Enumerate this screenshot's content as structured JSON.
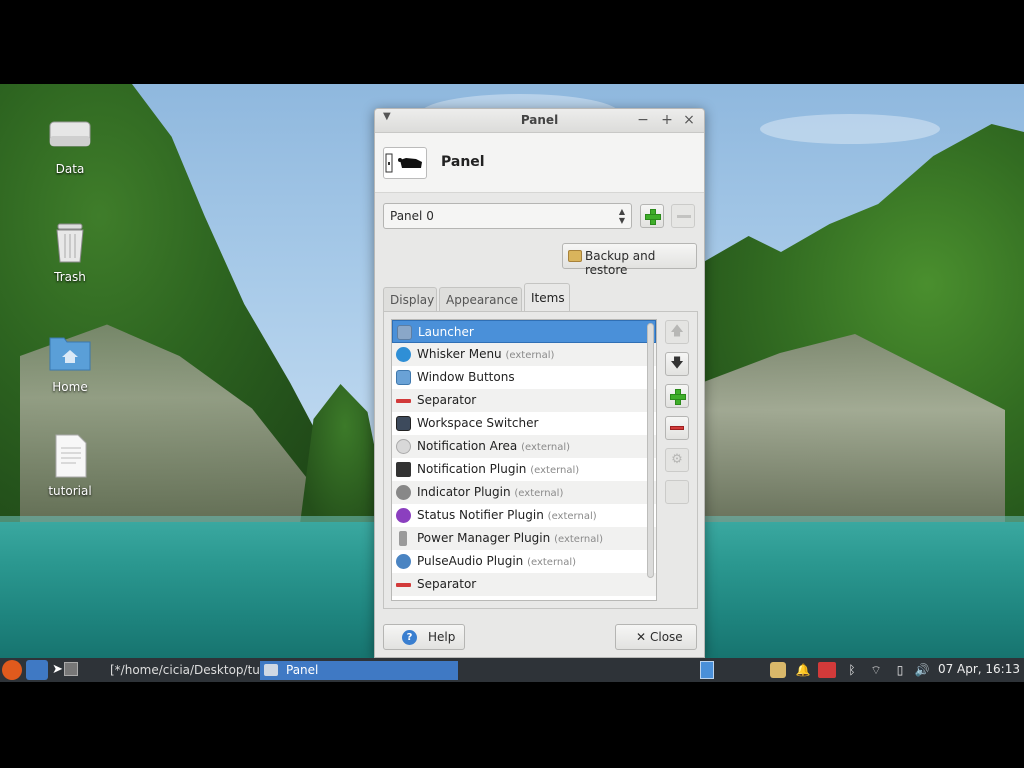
{
  "desktop": {
    "icons": [
      {
        "label": "Data",
        "icon": "drive-icon"
      },
      {
        "label": "Trash",
        "icon": "trash-icon"
      },
      {
        "label": "Home",
        "icon": "home-folder-icon"
      },
      {
        "label": "tutorial",
        "icon": "document-icon"
      }
    ]
  },
  "window": {
    "title": "Panel",
    "header_title": "Panel",
    "panel_select": "Panel 0",
    "backup_label": "Backup and restore",
    "tabs": [
      {
        "label": "Display",
        "active": false
      },
      {
        "label": "Appearance",
        "active": false
      },
      {
        "label": "Items",
        "active": true
      }
    ],
    "items": [
      {
        "name": "Launcher",
        "ext": "",
        "selected": true,
        "icon": "launcher-icon"
      },
      {
        "name": "Whisker Menu",
        "ext": "(external)",
        "selected": false,
        "icon": "whisker-menu-icon"
      },
      {
        "name": "Window Buttons",
        "ext": "",
        "selected": false,
        "icon": "window-buttons-icon"
      },
      {
        "name": "Separator",
        "ext": "",
        "selected": false,
        "icon": "separator-icon"
      },
      {
        "name": "Workspace Switcher",
        "ext": "",
        "selected": false,
        "icon": "workspace-switcher-icon"
      },
      {
        "name": "Notification Area",
        "ext": "(external)",
        "selected": false,
        "icon": "notification-area-icon"
      },
      {
        "name": "Notification Plugin",
        "ext": "(external)",
        "selected": false,
        "icon": "notification-plugin-icon"
      },
      {
        "name": "Indicator Plugin",
        "ext": "(external)",
        "selected": false,
        "icon": "indicator-plugin-icon"
      },
      {
        "name": "Status Notifier Plugin",
        "ext": "(external)",
        "selected": false,
        "icon": "status-notifier-icon"
      },
      {
        "name": "Power Manager Plugin",
        "ext": "(external)",
        "selected": false,
        "icon": "power-manager-icon"
      },
      {
        "name": "PulseAudio Plugin",
        "ext": "(external)",
        "selected": false,
        "icon": "pulseaudio-icon"
      },
      {
        "name": "Separator",
        "ext": "",
        "selected": false,
        "icon": "separator-icon"
      }
    ],
    "help_label": "Help",
    "close_label": "Close"
  },
  "taskbar": {
    "tasks": [
      {
        "label": "[*/home/cicia/Desktop/tutori...",
        "active": false
      },
      {
        "label": "Panel",
        "active": true
      }
    ],
    "clock": "07 Apr, 16:13"
  },
  "colors": {
    "selection": "#4a90d9",
    "taskbar": "#2e3338",
    "add_green": "#3fae2a",
    "remove_red": "#d23a3a"
  }
}
